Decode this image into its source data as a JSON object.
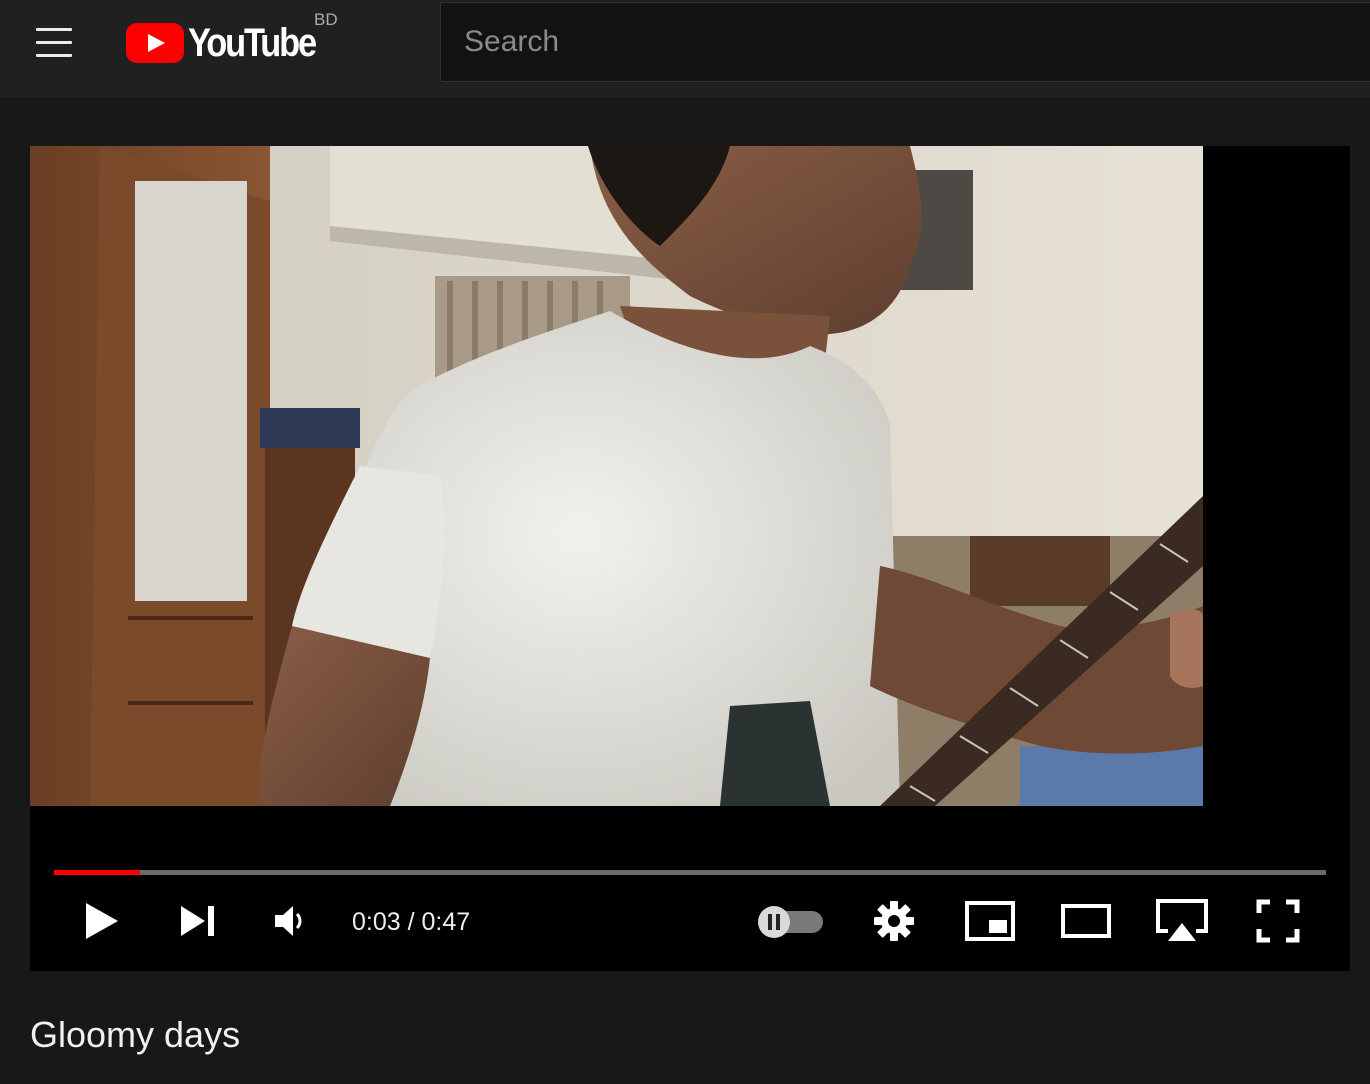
{
  "header": {
    "logo_text": "YouTube",
    "country_code": "BD",
    "search": {
      "placeholder": "Search",
      "value": ""
    }
  },
  "player": {
    "current_time": "0:03",
    "time_separator": " / ",
    "duration": "0:47",
    "progress_fraction": 0.068,
    "state": "paused",
    "autoplay_enabled": false
  },
  "icons": {
    "menu": "hamburger-icon",
    "play": "play-icon",
    "next": "next-track-icon",
    "volume": "volume-icon",
    "autoplay": "autoplay-toggle-icon",
    "settings": "gear-icon",
    "miniplayer": "miniplayer-icon",
    "theater": "theater-mode-icon",
    "airplay": "airplay-icon",
    "fullscreen": "fullscreen-icon"
  },
  "colors": {
    "brand_red": "#ff0000",
    "background": "#181818",
    "masthead": "#202020"
  },
  "video": {
    "title": "Gloomy days"
  }
}
